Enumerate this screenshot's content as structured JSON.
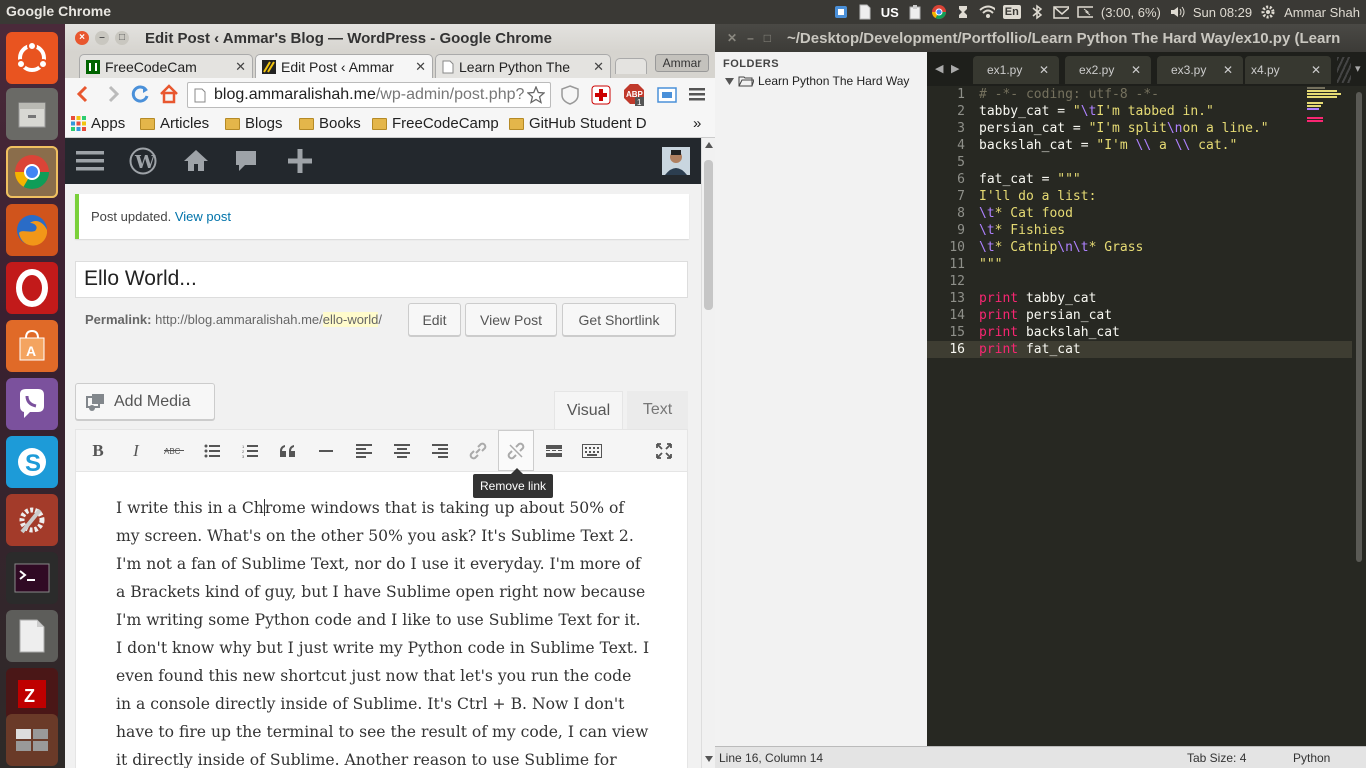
{
  "system": {
    "app_name": "Google Chrome",
    "keyboard_layout": "US",
    "battery": "(3:00, 6%)",
    "input_lang": "En",
    "clock": "Sun 08:29",
    "user": "Ammar Shah"
  },
  "launcher": {
    "items": [
      "ubuntu-dash-icon",
      "files-icon",
      "chrome-icon",
      "firefox-icon",
      "opera-icon",
      "software-center-icon",
      "viber-icon",
      "skype-icon",
      "system-settings-icon",
      "terminal-icon",
      "libreoffice-icon",
      "filezilla-icon",
      "workspace-switcher-icon"
    ]
  },
  "chrome": {
    "window_title": "Edit Post ‹ Ammar's Blog — WordPress - Google Chrome",
    "tabs": [
      {
        "label": "FreeCodeCam",
        "active": false
      },
      {
        "label": "Edit Post ‹ Ammar",
        "active": true
      },
      {
        "label": "Learn Python The",
        "active": false
      }
    ],
    "profile": "Ammar",
    "url_host": "blog.ammaralishah.me",
    "url_path": "/wp-admin/post.php?",
    "bookmarks": [
      "Apps",
      "Articles",
      "Blogs",
      "Books",
      "FreeCodeCamp",
      "GitHub Student D"
    ],
    "more_bookmarks": "»"
  },
  "wp": {
    "notice_text": "Post updated.",
    "notice_link": "View post",
    "post_title": "Ello World...",
    "permalink_label": "Permalink:",
    "permalink_base": "http://blog.ammaralishah.me/",
    "permalink_slug": "ello-world",
    "permalink_end": "/",
    "edit_button": "Edit",
    "view_post_button": "View Post",
    "shortlink_button": "Get Shortlink",
    "add_media": "Add Media",
    "tab_visual": "Visual",
    "tab_text": "Text",
    "tooltip": "Remove link",
    "content_before_caret": "I write this in a Ch",
    "content_after_caret": "rome windows that is taking up about 50% of my screen. What's on the other 50% you ask? It's Sublime Text 2. I'm not a fan of Sublime Text, nor do I use it everyday. I'm more of a Brackets kind of guy, but I have Sublime open right now because I'm writing some Python code and I like to use Sublime Text for it. I don't know why but I just write my Python code in Sublime Text. I even found this new shortcut just now that let's you run the code in a console directly inside of Sublime. It's Ctrl + B. Now I don't have to fire up the terminal to see the result of my code, I can view it directly inside of Sublime. Another reason to use Sublime for Python."
  },
  "sublime": {
    "window_title": "~/Desktop/Development/Portfollio/Learn Python The Hard Way/ex10.py (Learn",
    "sidebar_header": "FOLDERS",
    "folder": "Learn Python The Hard Way",
    "tabs": [
      "ex1.py",
      "ex2.py",
      "ex3.py",
      "x4.py"
    ],
    "line_numbers": [
      "1",
      "2",
      "3",
      "4",
      "5",
      "6",
      "7",
      "8",
      "9",
      "10",
      "11",
      "12",
      "13",
      "14",
      "15",
      "16"
    ],
    "status_position": "Line 16, Column 14",
    "status_tabsize": "Tab Size: 4",
    "status_syntax": "Python"
  },
  "colors": {
    "wp_accent": "#0073aa",
    "notice_success": "#7ad03a",
    "monokai_bg": "#272822",
    "monokai_keyword": "#f92672",
    "monokai_string": "#e6db74",
    "monokai_escape": "#ae81ff",
    "monokai_comment": "#75715e"
  }
}
